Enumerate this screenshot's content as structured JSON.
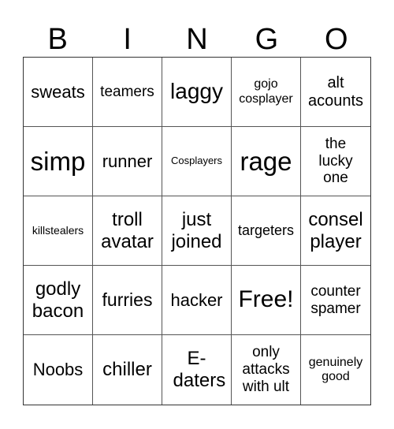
{
  "header": [
    "B",
    "I",
    "N",
    "G",
    "O"
  ],
  "cells": [
    [
      "sweats",
      "teamers",
      "laggy",
      "gojo cosplayer",
      "alt acounts"
    ],
    [
      "simp",
      "runner",
      "Cosplayers",
      "rage",
      "the lucky one"
    ],
    [
      "killstealers",
      "troll avatar",
      "just joined",
      "targeters",
      "consel player"
    ],
    [
      "godly bacon",
      "furries",
      "hacker",
      "Free!",
      "counter spamer"
    ],
    [
      "Noobs",
      "chiller",
      "E-daters",
      "only attacks with ult",
      "genuinely good"
    ]
  ]
}
